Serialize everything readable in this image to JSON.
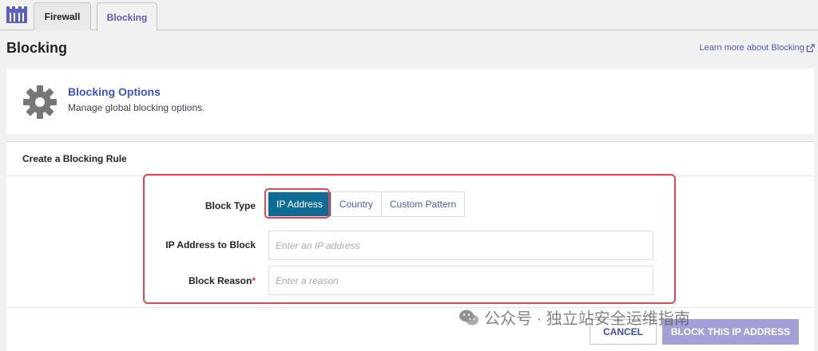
{
  "tabs": {
    "firewall": "Firewall",
    "blocking": "Blocking"
  },
  "page": {
    "title": "Blocking",
    "learn_more": "Learn more about Blocking"
  },
  "options": {
    "title": "Blocking Options",
    "description": "Manage global blocking options."
  },
  "rule": {
    "title": "Create a Blocking Rule",
    "block_type_label": "Block Type",
    "types": [
      "IP Address",
      "Country",
      "Custom Pattern"
    ],
    "active_type": "IP Address",
    "ip_label": "IP Address to Block",
    "ip_placeholder": "Enter an IP address",
    "reason_label": "Block Reason",
    "reason_required_mark": "*",
    "reason_placeholder": "Enter a reason",
    "cancel": "CANCEL",
    "submit": "BLOCK THIS IP ADDRESS"
  },
  "watermark": "公众号 · 独立站安全运维指南",
  "colors": {
    "accent": "#5f5ab8",
    "active_segment": "#0e6b94",
    "submit_button": "#a3a0d8",
    "highlight": "#e0484e"
  }
}
